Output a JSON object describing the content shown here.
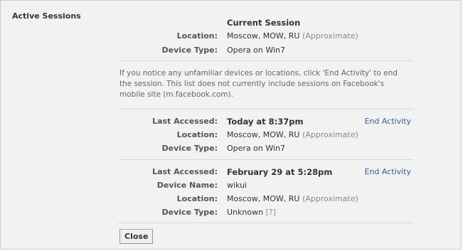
{
  "section_title": "Active Sessions",
  "current_session": {
    "heading": "Current Session",
    "location_label": "Location:",
    "location_value": "Moscow, MOW, RU",
    "location_note": "(Approximate)",
    "device_type_label": "Device Type:",
    "device_type_value": "Opera on Win7"
  },
  "notice": "If you notice any unfamiliar devices or locations, click 'End Activity' to end the session. This list does not currently include sessions on Facebook's mobile site (m.facebook.com).",
  "sessions": [
    {
      "last_accessed_label": "Last Accessed:",
      "last_accessed_value": "Today at 8:37pm",
      "end_activity": "End Activity",
      "location_label": "Location:",
      "location_value": "Moscow, MOW, RU",
      "location_note": "(Approximate)",
      "device_type_label": "Device Type:",
      "device_type_value": "Opera on Win7"
    },
    {
      "last_accessed_label": "Last Accessed:",
      "last_accessed_value": "February 29 at 5:28pm",
      "end_activity": "End Activity",
      "device_name_label": "Device Name:",
      "device_name_value": "wikui",
      "location_label": "Location:",
      "location_value": "Moscow, MOW, RU",
      "location_note": "(Approximate)",
      "device_type_label": "Device Type:",
      "device_type_value": "Unknown",
      "device_type_help": "[?]"
    }
  ],
  "close_label": "Close",
  "colors": {
    "panel_bg": "#f2f2f2",
    "link": "#3b5998",
    "border": "#cccccc",
    "muted": "#8a8a8a"
  }
}
